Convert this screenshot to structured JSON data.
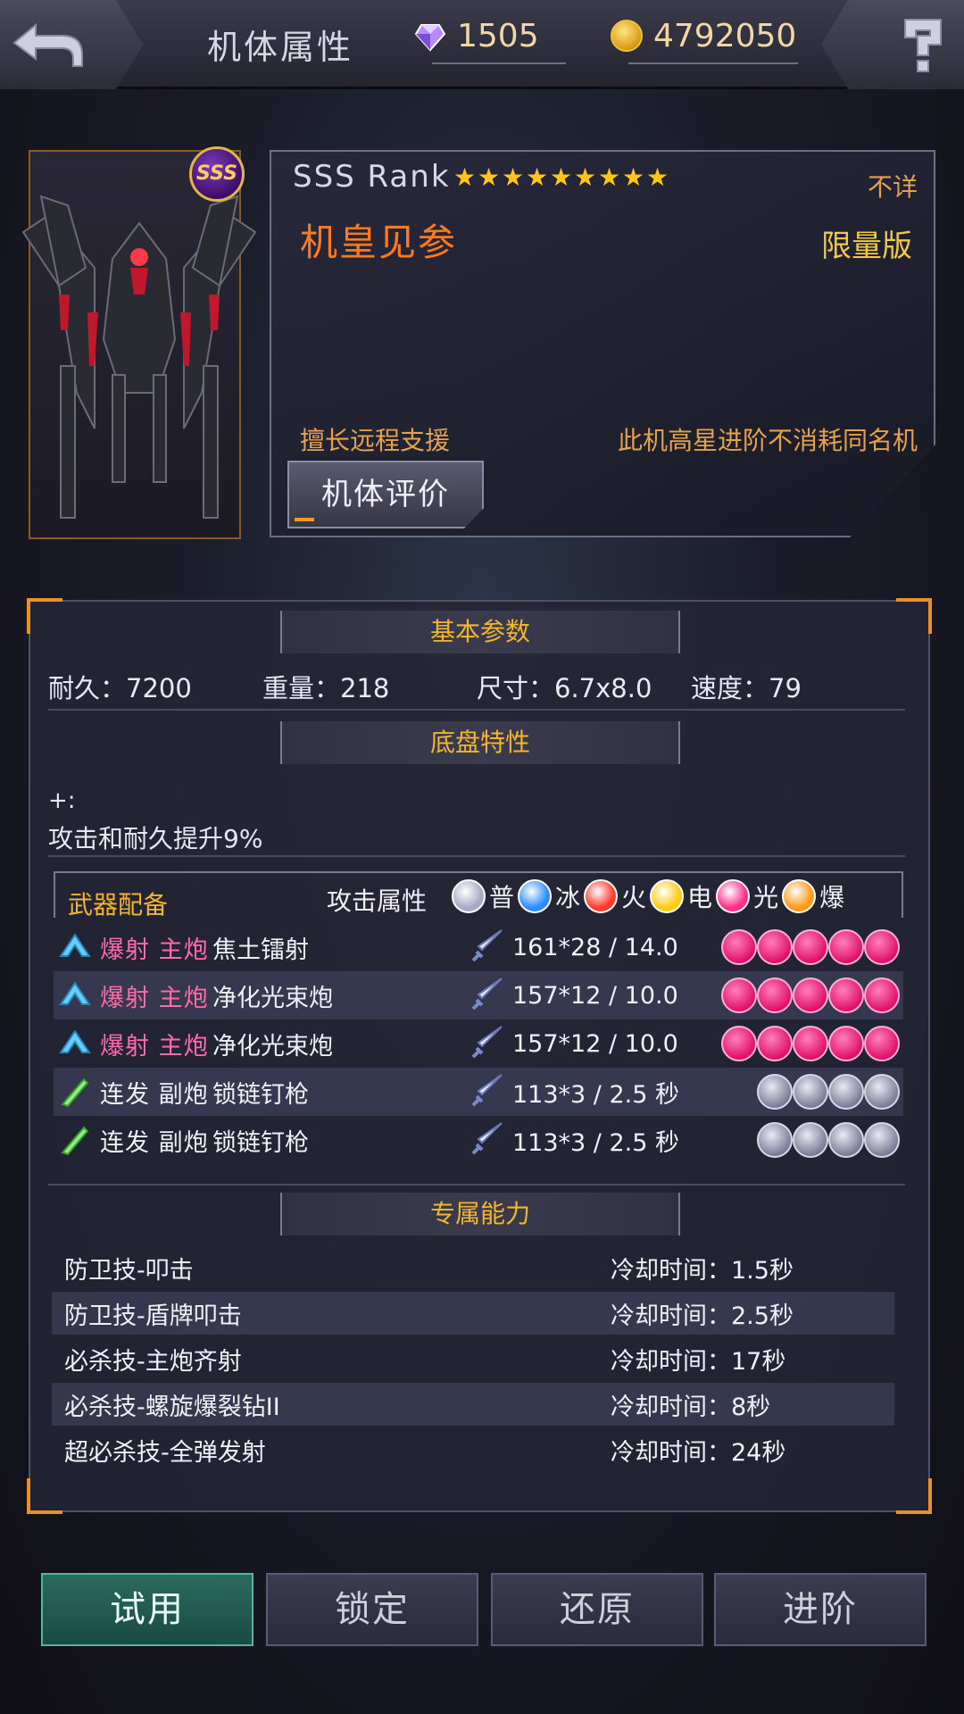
{
  "header": {
    "title": "机体属性",
    "gems": "1505",
    "coins": "4792050"
  },
  "mech": {
    "rank_badge": "SSS",
    "rank_label": "SSS  Rank",
    "star_count": 9,
    "unknown": "不详",
    "name": "机皇见参",
    "edition": "限量版",
    "specialty": "擅长远程支援",
    "note": "此机高星进阶不消耗同名机",
    "eval_button": "机体评价"
  },
  "basic": {
    "title": "基本参数",
    "durability": "耐久：7200",
    "weight": "重量：218",
    "size": "尺寸：6.7x8.0",
    "speed": "速度：79"
  },
  "chassis": {
    "title": "底盘特性",
    "plus": "+:",
    "text": "攻击和耐久提升9%"
  },
  "weapons": {
    "title": "武器配备",
    "attr_label": "攻击属性",
    "elements": [
      {
        "label": "普",
        "color": "#a9a9c8"
      },
      {
        "label": "冰",
        "color": "#2d8cff"
      },
      {
        "label": "火",
        "color": "#ff3b2a"
      },
      {
        "label": "电",
        "color": "#ffcc12"
      },
      {
        "label": "光",
        "color": "#ff2f8a"
      },
      {
        "label": "爆",
        "color": "#ff9a1a"
      }
    ],
    "rows": [
      {
        "type": "爆射 主炮",
        "name": "焦土镭射",
        "stats": "161*28  / 14.0",
        "pips": 5,
        "pip_kind": "light"
      },
      {
        "type": "爆射 主炮",
        "name": "净化光束炮",
        "stats": "157*12  / 10.0",
        "pips": 5,
        "pip_kind": "light"
      },
      {
        "type": "爆射 主炮",
        "name": "净化光束炮",
        "stats": "157*12  / 10.0",
        "pips": 5,
        "pip_kind": "light"
      },
      {
        "type": "连发 副炮",
        "name": "锁链钉枪",
        "stats": "113*3  / 2.5 秒",
        "pips": 4,
        "pip_kind": "normal"
      },
      {
        "type": "连发 副炮",
        "name": "锁链钉枪",
        "stats": "113*3  / 2.5 秒",
        "pips": 4,
        "pip_kind": "normal"
      }
    ]
  },
  "skills": {
    "title": "专属能力",
    "rows": [
      {
        "name": "防卫技-叩击",
        "cooldown": "冷却时间：1.5秒"
      },
      {
        "name": "防卫技-盾牌叩击",
        "cooldown": "冷却时间：2.5秒"
      },
      {
        "name": "必杀技-主炮齐射",
        "cooldown": "冷却时间：17秒"
      },
      {
        "name": "必杀技-螺旋爆裂钻II",
        "cooldown": "冷却时间：8秒"
      },
      {
        "name": "超必杀技-全弹发射",
        "cooldown": "冷却时间：24秒"
      }
    ]
  },
  "buttons": {
    "trial": "试用",
    "lock": "锁定",
    "restore": "还原",
    "advance": "进阶"
  }
}
